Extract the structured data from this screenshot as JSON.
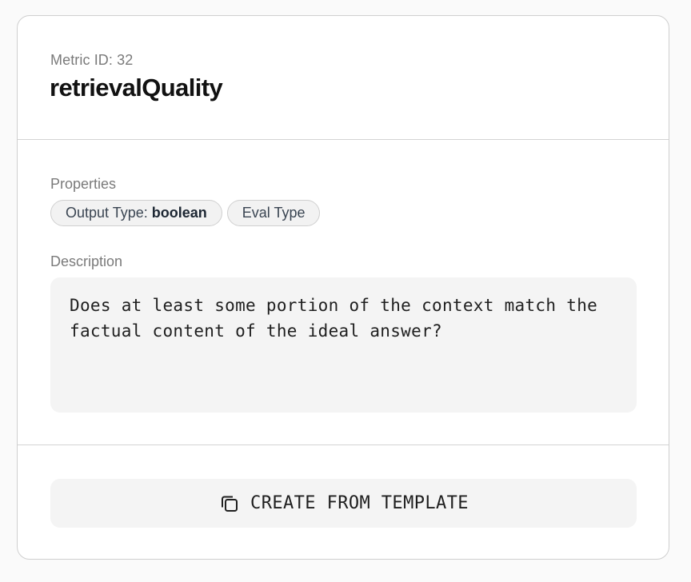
{
  "metric": {
    "id_label": "Metric ID: 32",
    "title": "retrievalQuality"
  },
  "properties": {
    "label": "Properties",
    "pills": [
      {
        "key": "Output Type:",
        "value": "boolean"
      },
      {
        "key": "Eval Type",
        "value": ""
      }
    ]
  },
  "description": {
    "label": "Description",
    "text": "Does at least some portion of the context match the factual content of the ideal answer?"
  },
  "actions": {
    "template_button_label": "CREATE FROM TEMPLATE",
    "template_button_icon": "copy-icon"
  },
  "colors": {
    "page_bg": "#fafafa",
    "card_bg": "#ffffff",
    "muted_text": "#7a7a7a",
    "pill_bg": "#f2f2f2",
    "box_bg": "#f4f4f4"
  }
}
